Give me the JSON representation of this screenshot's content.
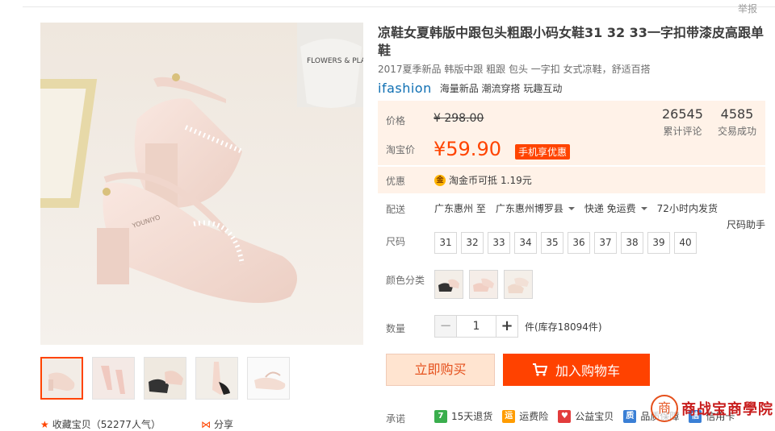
{
  "report_link": "举报",
  "product": {
    "title": "凉鞋女夏韩版中跟包头粗跟小码女鞋31 32 33一字扣带漆皮高跟单鞋",
    "subtitle": "2017夏季新品 韩版中跟 粗跟 包头 一字扣 女式凉鞋，舒适百搭",
    "brand_logo": "ifashion",
    "brand_tagline": "海量新品 潮流穿搭 玩趣互动"
  },
  "pricing": {
    "price_label": "价格",
    "original_price": "¥ 298.00",
    "taobao_price_label": "淘宝价",
    "sale_price": "¥59.90",
    "promo_badge": "手机享优惠",
    "reviews_count": "26545",
    "reviews_label": "累计评论",
    "transactions_count": "4585",
    "transactions_label": "交易成功",
    "discount_label": "优惠",
    "coin_icon_text": "金",
    "coin_text": "淘金币可抵",
    "coin_amount": "1.19元"
  },
  "shipping": {
    "label": "配送",
    "from": "广东惠州 至",
    "to": "广东惠州博罗县",
    "method": "快递 免运费",
    "dispatch": "72小时内发货"
  },
  "size": {
    "label": "尺码",
    "helper": "尺码助手",
    "options": [
      "31",
      "32",
      "33",
      "34",
      "35",
      "36",
      "37",
      "38",
      "39",
      "40"
    ]
  },
  "color": {
    "label": "颜色分类"
  },
  "quantity": {
    "label": "数量",
    "minus": "−",
    "value": "1",
    "plus": "+",
    "stock": "件(库存18094件)"
  },
  "buttons": {
    "buy_now": "立即购买",
    "add_cart": "加入购物车"
  },
  "promise": {
    "label": "承诺",
    "items": [
      {
        "badge": "7",
        "text": "15天退货",
        "color": "#3aae4d"
      },
      {
        "badge": "运",
        "text": "运费险",
        "color": "#ff9c00"
      },
      {
        "badge": "♥",
        "text": "公益宝贝",
        "color": "#e23c3c"
      },
      {
        "badge": "质",
        "text": "品质保障",
        "color": "#3a7fd5"
      },
      {
        "badge": "信",
        "text": "信用卡",
        "color": "#3a7fd5"
      }
    ]
  },
  "gallery": {
    "favorite": "收藏宝贝（52277人气）",
    "share": "分享",
    "product_print": "FLOWERS & PLANTS",
    "shoe_print": "YOUNIYO"
  },
  "watermark": {
    "seal": "商",
    "text": "商战宝商學院"
  },
  "colors": {
    "accent": "#ff4400",
    "price_bg": "#fff2e8",
    "cart_btn": "#ff4200"
  }
}
